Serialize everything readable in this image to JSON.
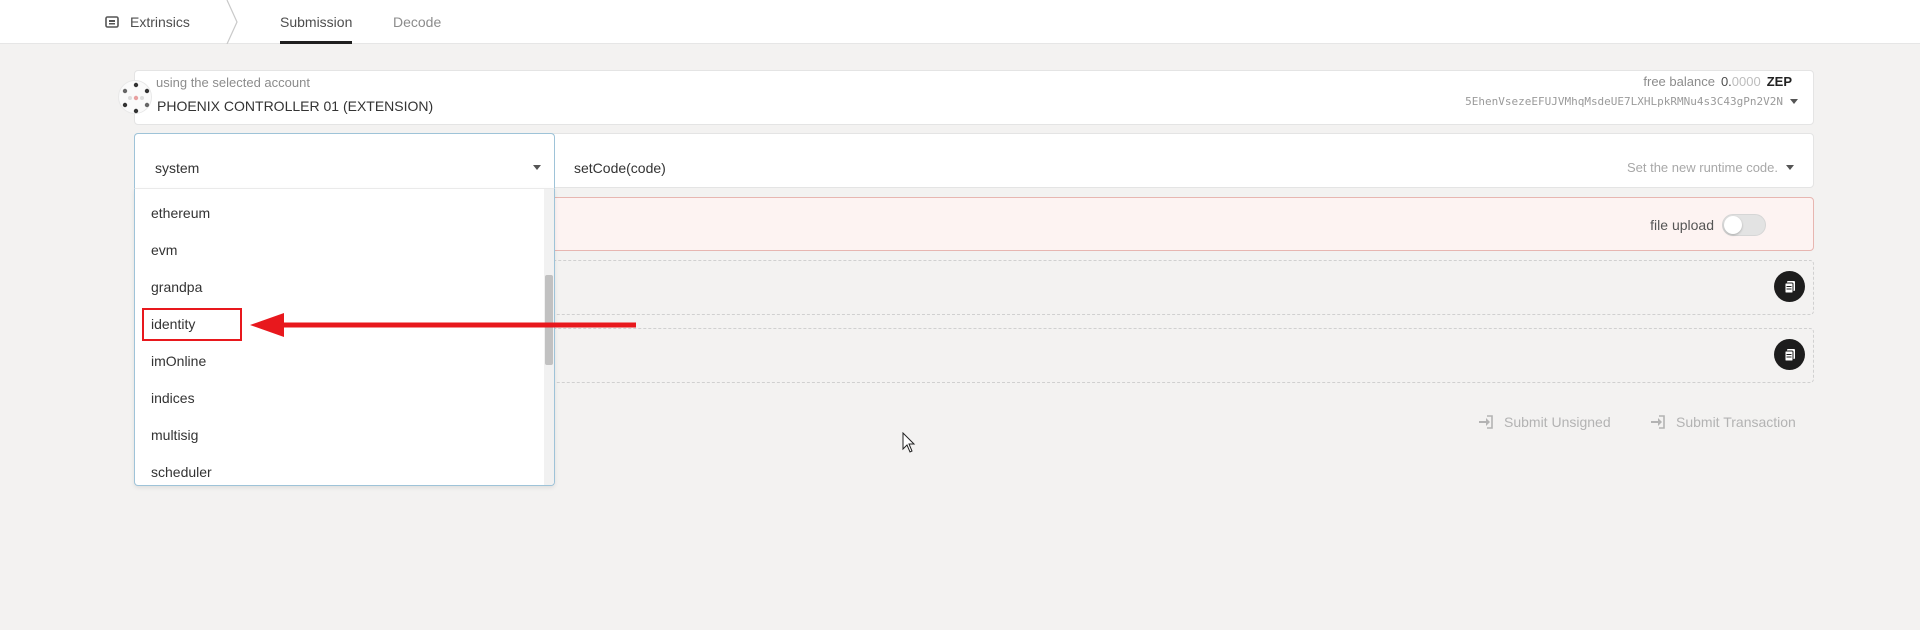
{
  "nav": {
    "section_label": "Extrinsics",
    "tabs": [
      {
        "label": "Submission",
        "active": true
      },
      {
        "label": "Decode",
        "active": false
      }
    ]
  },
  "account": {
    "label": "using the selected account",
    "name": "PHOENIX CONTROLLER 01 (EXTENSION)",
    "balance_label": "free balance",
    "balance_integer": "0.",
    "balance_decimals": "0000",
    "balance_unit": "ZEP",
    "address": "5EhenVsezeEFUJVMhqMsdeUE7LXHLpkRMNu4s3C43gPn2V2N"
  },
  "section_select": {
    "value": "system",
    "options": [
      "ethereum",
      "evm",
      "grandpa",
      "identity",
      "imOnline",
      "indices",
      "multisig",
      "scheduler"
    ],
    "highlighted": "identity"
  },
  "method": {
    "name": "setCode(code)",
    "description": "Set the new runtime code."
  },
  "param": {
    "file_upload_label": "file upload",
    "file_upload_on": false
  },
  "actions": {
    "submit_unsigned": "Submit Unsigned",
    "submit_transaction": "Submit Transaction"
  },
  "colors": {
    "annotation_red": "#e8181d",
    "param_error_bg": "#fdf3f2",
    "button_dark": "#1d1d1d"
  }
}
